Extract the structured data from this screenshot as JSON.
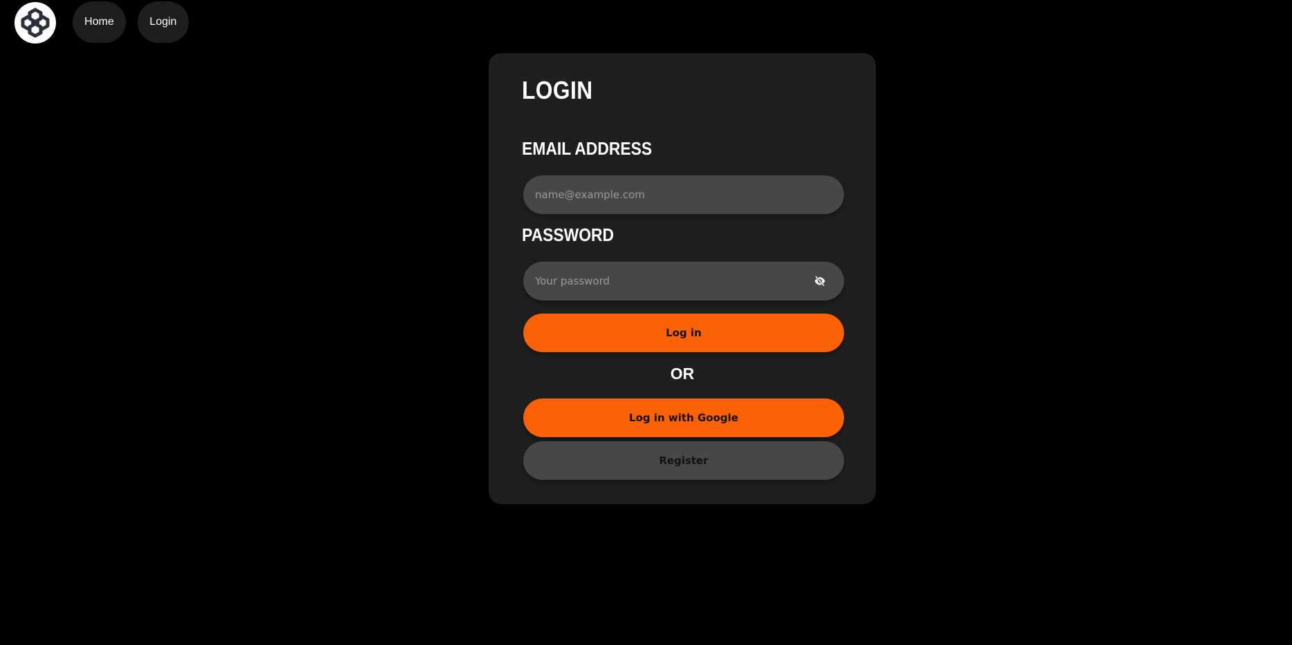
{
  "nav": {
    "logo_icon": "hexagon-knot-logo-icon",
    "items": [
      {
        "label": "Home"
      },
      {
        "label": "Login"
      }
    ]
  },
  "login_card": {
    "title": "LOGIN",
    "email": {
      "label": "EMAIL ADDRESS",
      "value": "",
      "placeholder": "name@example.com"
    },
    "password": {
      "label": "PASSWORD",
      "value": "",
      "placeholder": "Your password",
      "toggle_icon": "eye-slash-icon"
    },
    "login_button": "Log in",
    "separator": "OR",
    "google_button": "Log in with Google",
    "register_button": "Register"
  },
  "colors": {
    "background": "#000000",
    "card": "#1f1f1f",
    "accent": "#ff6105",
    "field": "#474747",
    "nav_button": "#1e1e1e"
  }
}
